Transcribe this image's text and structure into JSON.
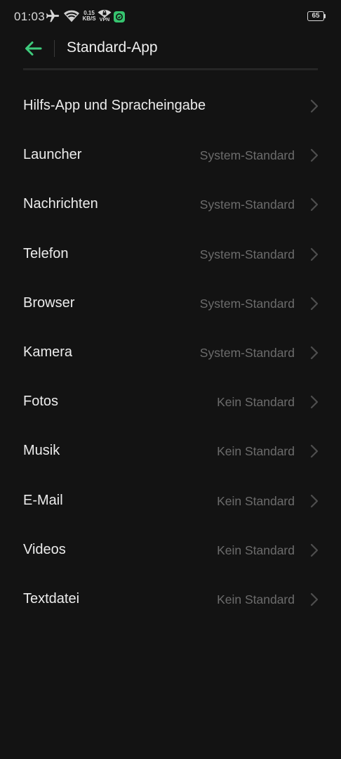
{
  "status_bar": {
    "time": "01:03",
    "net_speed_value": "0.15",
    "net_speed_unit": "KB/S",
    "vpn_label": "VPN",
    "battery_level": "65",
    "icons": [
      "airplane-icon",
      "wifi-icon",
      "vpn-icon",
      "app-notification-icon",
      "battery-icon"
    ]
  },
  "header": {
    "title": "Standard-App",
    "back_icon": "arrow-left-icon"
  },
  "colors": {
    "background": "#131313",
    "accent": "#3ecb7c",
    "primary_text": "#ececec",
    "secondary_text": "#6c6c6c"
  },
  "items": [
    {
      "label": "Hilfs-App und Spracheingabe",
      "value": ""
    },
    {
      "label": "Launcher",
      "value": "System-Standard"
    },
    {
      "label": "Nachrichten",
      "value": "System-Standard"
    },
    {
      "label": "Telefon",
      "value": "System-Standard"
    },
    {
      "label": "Browser",
      "value": "System-Standard"
    },
    {
      "label": "Kamera",
      "value": "System-Standard"
    },
    {
      "label": "Fotos",
      "value": "Kein Standard"
    },
    {
      "label": "Musik",
      "value": "Kein Standard"
    },
    {
      "label": "E-Mail",
      "value": "Kein Standard"
    },
    {
      "label": "Videos",
      "value": "Kein Standard"
    },
    {
      "label": "Textdatei",
      "value": "Kein Standard"
    }
  ]
}
